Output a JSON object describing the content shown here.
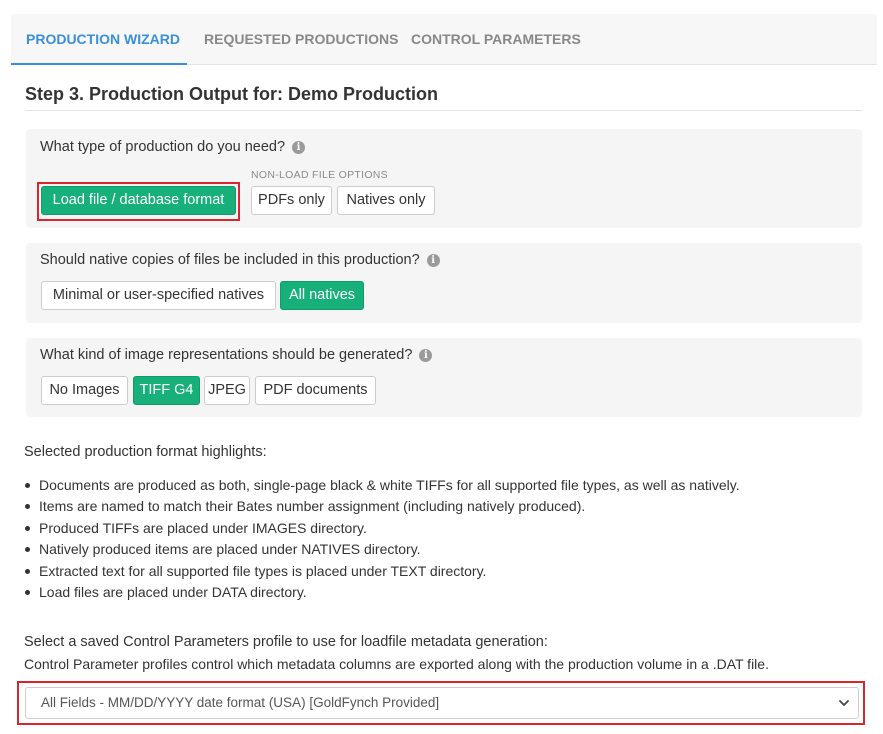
{
  "tabs": [
    {
      "label": "PRODUCTION WIZARD",
      "active": true
    },
    {
      "label": "REQUESTED PRODUCTIONS",
      "active": false
    },
    {
      "label": "CONTROL PARAMETERS",
      "active": false
    }
  ],
  "step": {
    "title": "Step 3. Production Output for: Demo Production"
  },
  "production_type": {
    "question": "What type of production do you need?",
    "info_icon": "info-icon",
    "load_file_button": "Load file / database format",
    "non_load_label": "NON-LOAD FILE OPTIONS",
    "pdfs_button": "PDFs only",
    "natives_button": "Natives only",
    "selected": "Load file / database format"
  },
  "native_copies": {
    "question": "Should native copies of files be included in this production?",
    "info_icon": "info-icon",
    "minimal_button": "Minimal or user-specified natives",
    "all_button": "All natives",
    "selected": "All natives"
  },
  "image_representations": {
    "question": "What kind of image representations should be generated?",
    "info_icon": "info-icon",
    "no_images_button": "No Images",
    "tiff_button": "TIFF G4",
    "jpeg_button": "JPEG",
    "pdf_button": "PDF documents",
    "selected": "TIFF G4"
  },
  "highlights": {
    "title": "Selected production format highlights:",
    "items": [
      "Documents are produced as both, single-page black & white TIFFs for all supported file types, as well as natively.",
      "Items are named to match their Bates number assignment (including natively produced).",
      "Produced TIFFs are placed under IMAGES directory.",
      "Natively produced items are placed under NATIVES directory.",
      "Extracted text for all supported file types is placed under TEXT directory.",
      "Load files are placed under DATA directory."
    ]
  },
  "control_params": {
    "title": "Select a saved Control Parameters profile to use for loadfile metadata generation:",
    "description": "Control Parameter profiles control which metadata columns are exported along with the production volume in a .DAT file.",
    "selected_value": "All Fields - MM/DD/YYYY date format (USA) [GoldFynch Provided]",
    "chevron_icon": "chevron-down-icon"
  },
  "colors": {
    "accent": "#3a8fd8",
    "selected_green": "#17b07a",
    "highlight_red": "#d9262c"
  }
}
